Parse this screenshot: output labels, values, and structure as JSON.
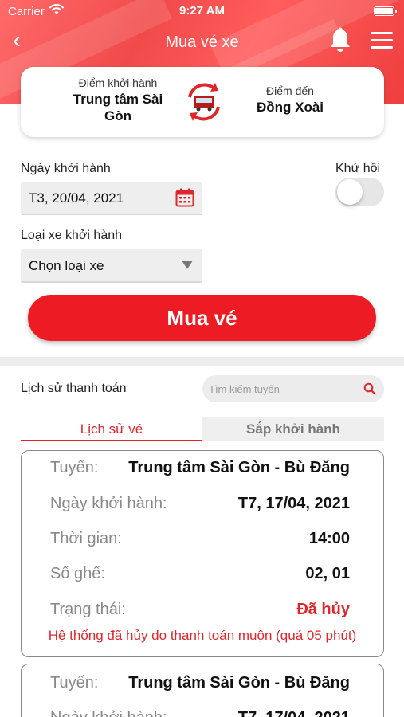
{
  "status_bar": {
    "carrier": "Carrier",
    "time": "9:27 AM"
  },
  "nav": {
    "title": "Mua vé xe",
    "back": "‹"
  },
  "route": {
    "from_label": "Điểm khởi hành",
    "from_value": "Trung tâm Sài Gòn",
    "to_label": "Điểm đến",
    "to_value": "Đồng Xoài"
  },
  "form": {
    "date_label": "Ngày khởi hành",
    "date_value": "T3, 20/04, 2021",
    "round_trip_label": "Khứ hồi",
    "round_trip_on": false,
    "vehicle_label": "Loại xe khởi hành",
    "vehicle_value": "Chọn loại xe",
    "buy_button": "Mua vé"
  },
  "history": {
    "label": "Lịch sử thanh toán",
    "search_placeholder": "Tìm kiếm tuyến",
    "tabs": [
      "Lịch sử vé",
      "Sắp khởi hành"
    ],
    "tickets": [
      {
        "route_key": "Tuyến:",
        "route": "Trung tâm Sài Gòn - Bù Đăng",
        "date_key": "Ngày khởi hành:",
        "date": "T7, 17/04, 2021",
        "time_key": "Thời gian:",
        "time": "14:00",
        "seat_key": "Số ghế:",
        "seats": "02, 01",
        "status_key": "Trạng thái:",
        "status": "Đã hủy",
        "note": "Hệ thống đã hủy do thanh toán muộn (quá 05 phút)"
      },
      {
        "route_key": "Tuyến:",
        "route": "Trung tâm Sài Gòn - Bù Đăng",
        "date_key": "Ngày khởi hành:",
        "date": "T7, 17/04, 2021"
      }
    ]
  },
  "colors": {
    "primary": "#ed1c24",
    "status_cancelled": "#e0262a"
  }
}
